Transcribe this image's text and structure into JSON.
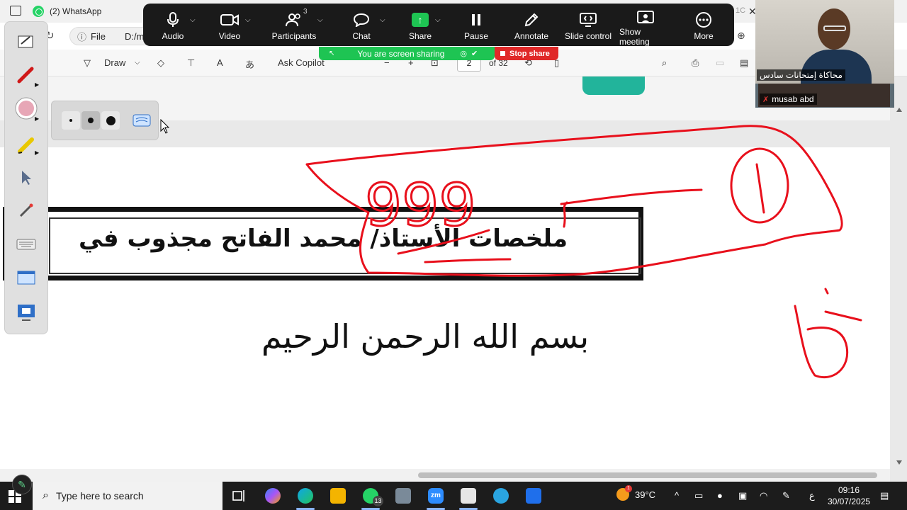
{
  "browser": {
    "tab_title": "(2) WhatsApp",
    "tab_extra": "1C",
    "address_label": "File",
    "address_path": "D:/m"
  },
  "pdf_toolbar": {
    "draw_label": "Draw",
    "copilot_label": "Ask Copilot",
    "page_current": "2",
    "page_total": "of 32"
  },
  "zoom": {
    "buttons": [
      {
        "label": "Audio"
      },
      {
        "label": "Video"
      },
      {
        "label": "Participants"
      },
      {
        "label": "Chat"
      },
      {
        "label": "Share"
      },
      {
        "label": "Pause"
      },
      {
        "label": "Annotate"
      },
      {
        "label": "Slide control"
      },
      {
        "label": "Show meeting"
      },
      {
        "label": "More"
      }
    ],
    "participant_count": "3",
    "sharing_text": "You are screen sharing",
    "stop_label": "Stop share",
    "participant_main": "محاكاة إمتحانات سادس",
    "participant_second": "musab abd"
  },
  "document": {
    "title": "ملخصات الأستاذ/ محمد الفاتح مجذوب في",
    "basmala": "بسم الله الرحمن الرحيم",
    "ink_number": "999"
  },
  "taskbar": {
    "search_placeholder": "Type here to search",
    "weather_temp": "39°C",
    "weather_badge": "1",
    "whatsapp_badge": "13",
    "lang": "ع",
    "time": "09:16",
    "date": "30/07/2025"
  },
  "colors": {
    "ink": "#e8101c",
    "zoom_green": "#1ec453",
    "zoom_red": "#e02828",
    "teal": "#22b49b"
  }
}
